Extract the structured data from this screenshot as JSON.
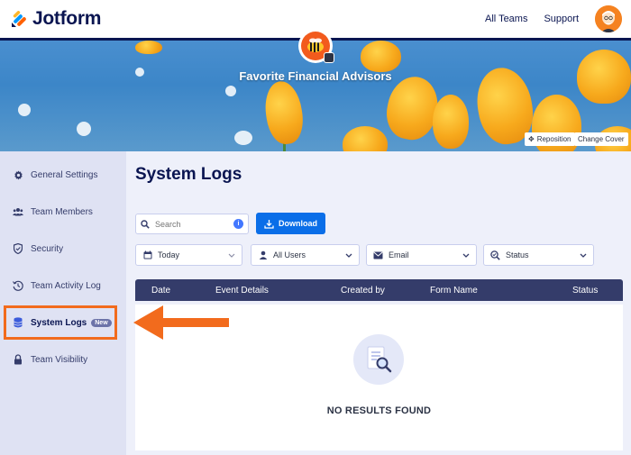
{
  "header": {
    "brand": "Jotform",
    "links": [
      "All Teams",
      "Support"
    ]
  },
  "cover": {
    "team_name": "Favorite Financial Advisors",
    "reposition_label": "Reposition",
    "change_cover_label": "Change Cover"
  },
  "sidebar": {
    "items": [
      {
        "label": "General Settings",
        "icon": "gear-icon"
      },
      {
        "label": "Team Members",
        "icon": "users-icon"
      },
      {
        "label": "Security",
        "icon": "shield-icon"
      },
      {
        "label": "Team Activity Log",
        "icon": "history-icon"
      },
      {
        "label": "System Logs",
        "icon": "database-icon",
        "badge": "New",
        "active": true
      },
      {
        "label": "Team Visibility",
        "icon": "lock-icon"
      }
    ]
  },
  "main": {
    "title": "System Logs",
    "search_placeholder": "Search",
    "download_label": "Download",
    "filters": {
      "date": "Today",
      "users": "All Users",
      "type": "Email",
      "status": "Status"
    },
    "table": {
      "columns": [
        "Date",
        "Event Details",
        "Created by",
        "Form Name",
        "Status"
      ]
    },
    "empty_message": "NO RESULTS FOUND"
  },
  "colors": {
    "brand_navy": "#0a1551",
    "primary_blue": "#0a6ee8",
    "highlight_orange": "#f26b1d",
    "table_header": "#343c6a"
  }
}
